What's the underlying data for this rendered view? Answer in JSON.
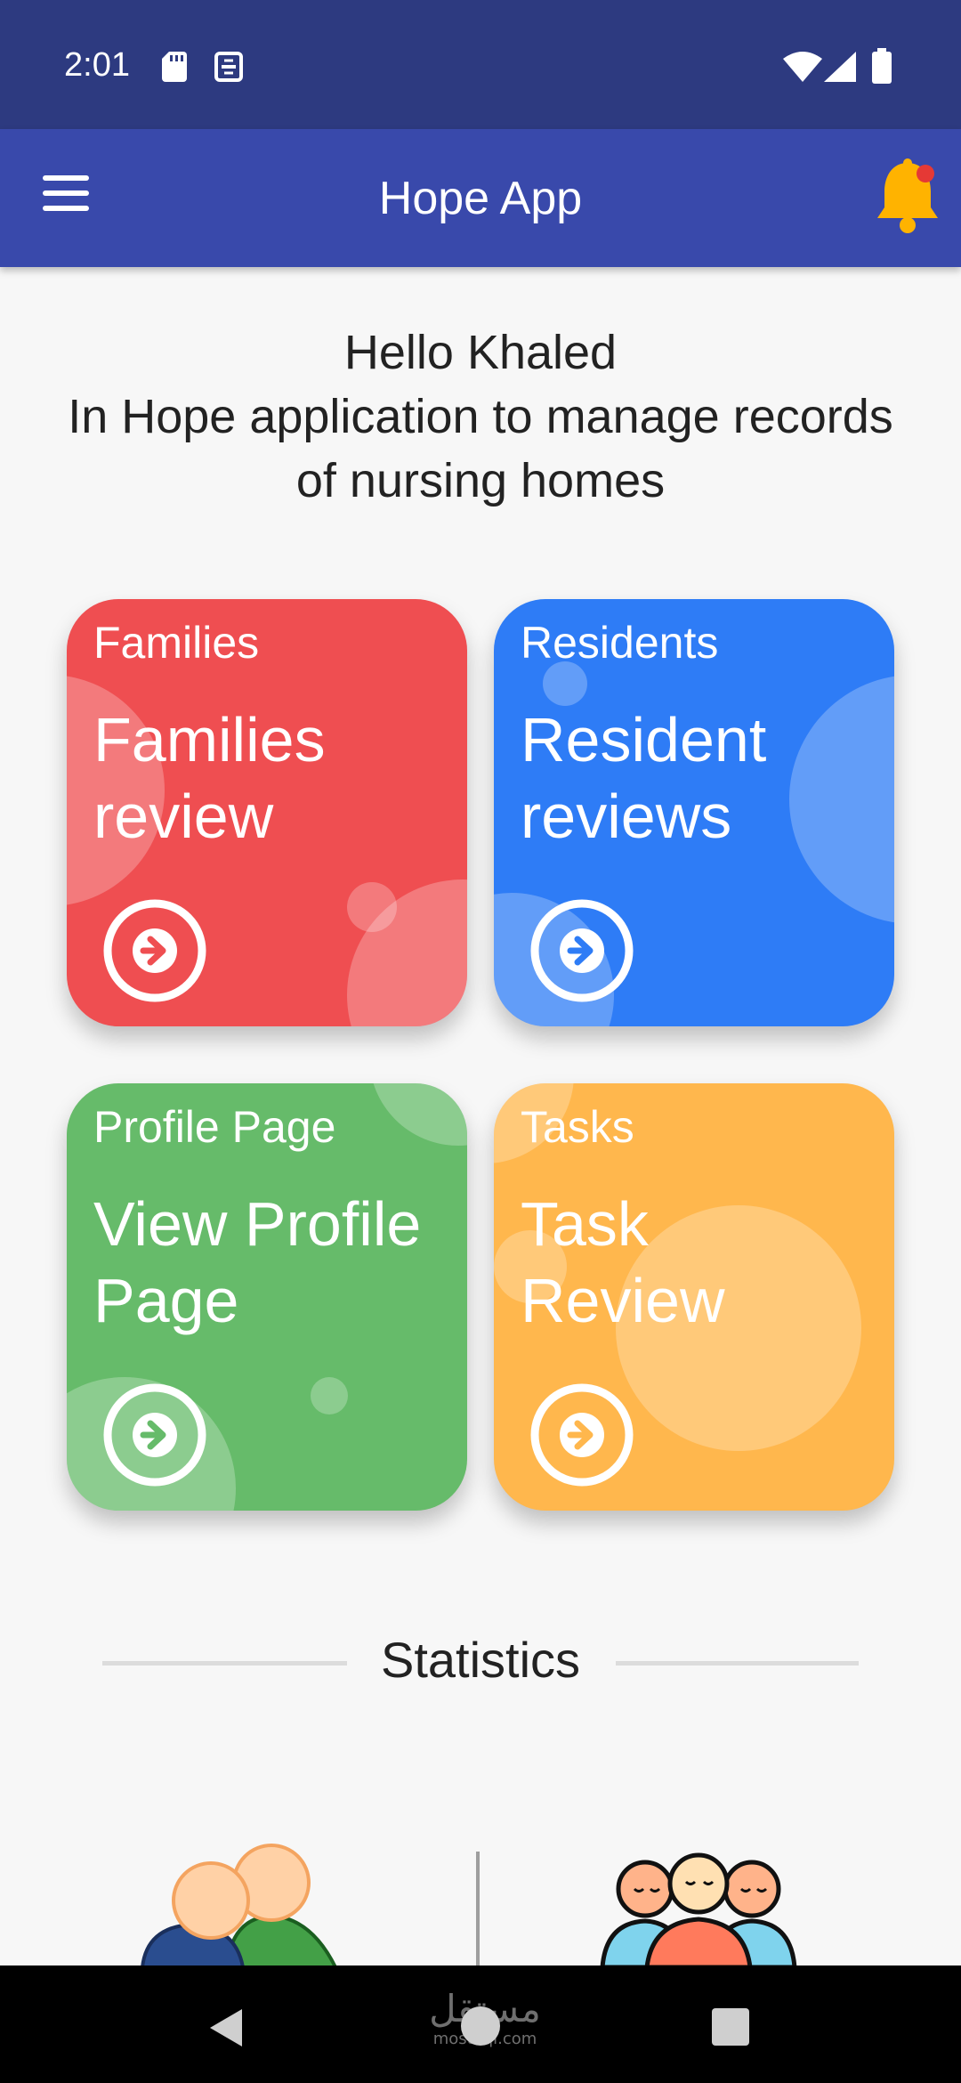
{
  "status_bar": {
    "time": "2:01",
    "icons": [
      "sd-card-icon",
      "sim-icon",
      "wifi-icon",
      "signal-icon",
      "battery-icon"
    ]
  },
  "app_bar": {
    "title": "Hope App",
    "left_icon": "menu-icon",
    "right_icon": "notification-bell-icon",
    "colors": {
      "bar": "#3949ab",
      "status": "#2d3a80",
      "bell": "#ffb300",
      "badge": "#e53935"
    }
  },
  "greeting": {
    "line1": "Hello Khaled",
    "line2": "In Hope application to manage records",
    "line3": "of nursing homes"
  },
  "cards": [
    {
      "category": "Families",
      "title_line1": "Families",
      "title_line2": "review",
      "color": "#ef4e51"
    },
    {
      "category": "Residents",
      "title_line1": "Resident",
      "title_line2": "reviews",
      "color": "#2e7cf6"
    },
    {
      "category": "Profile Page",
      "title_line1": "View Profile",
      "title_line2": "Page",
      "color": "#66bb6a"
    },
    {
      "category": "Tasks",
      "title_line1": "Task",
      "title_line2": "Review",
      "color": "#ffb74d"
    }
  ],
  "statistics": {
    "label": "Statistics",
    "icons": [
      "family-people-icon",
      "residents-group-icon"
    ]
  },
  "nav_bar": {
    "icons": [
      "back-icon",
      "home-icon",
      "recents-icon"
    ],
    "watermark_arabic": "مستقل",
    "watermark_url": "mostaql.com"
  }
}
